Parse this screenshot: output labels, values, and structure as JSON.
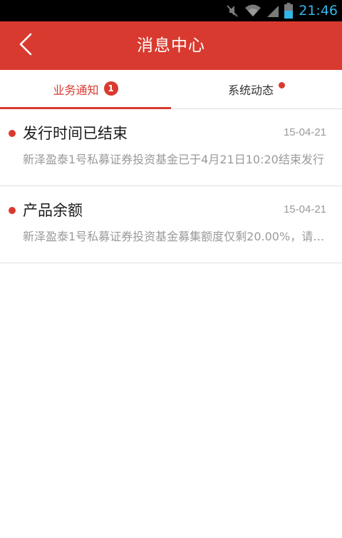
{
  "status_bar": {
    "time": "21:46",
    "icons": [
      "mute-icon",
      "wifi-icon",
      "signal-icon",
      "battery-icon"
    ],
    "color": "#33b5e5"
  },
  "header": {
    "title": "消息中心",
    "back_icon": "chevron-left-icon",
    "background": "#d93a2f"
  },
  "tabs": [
    {
      "label": "业务通知",
      "badge": "1",
      "active": true
    },
    {
      "label": "系统动态",
      "badge_dot": true,
      "active": false
    }
  ],
  "messages": [
    {
      "title": "发行时间已结束",
      "date": "15-04-21",
      "preview": "新泽盈泰1号私募证券投资基金已于4月21日10:20结束发行",
      "unread": true
    },
    {
      "title": "产品余额",
      "date": "15-04-21",
      "preview": "新泽盈泰1号私募证券投资基金募集额度仅剩20.00%，请尽快购买",
      "unread": true
    }
  ]
}
